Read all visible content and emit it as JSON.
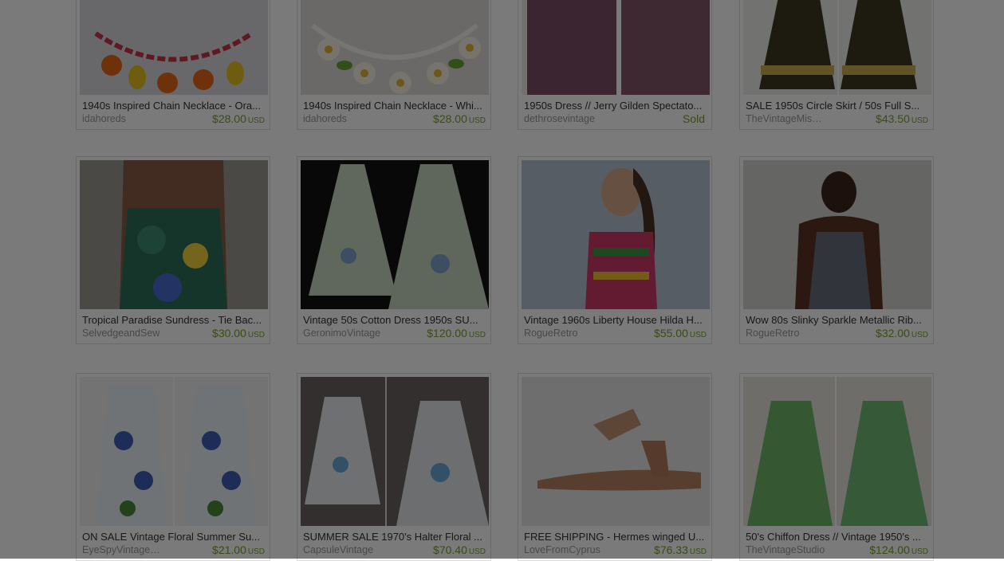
{
  "listings": [
    {
      "title": "1940s Inspired Chain Necklace - Ora...",
      "shop": "idahoreds",
      "price": "$28.00",
      "currency": "USD",
      "image": "orange-lemon-necklace"
    },
    {
      "title": "1940s Inspired Chain Necklace - Whi...",
      "shop": "idahoreds",
      "price": "$28.00",
      "currency": "USD",
      "image": "daisy-necklace"
    },
    {
      "title": "1950s Dress // Jerry Gilden Spectato...",
      "shop": "dethrosevintage",
      "price": "Sold",
      "currency": "",
      "image": "maroon-dress"
    },
    {
      "title": "SALE 1950s Circle Skirt / 50s Full S...",
      "shop": "TheVintageMis…",
      "price": "$43.50",
      "currency": "USD",
      "image": "circle-skirt"
    },
    {
      "title": "Tropical Paradise Sundress - Tie Bac...",
      "shop": "SelvedgeandSew",
      "price": "$30.00",
      "currency": "USD",
      "image": "tropical-sundress"
    },
    {
      "title": "Vintage 50s Cotton Dress 1950s SU...",
      "shop": "GeronimoVintage",
      "price": "$120.00",
      "currency": "USD",
      "image": "floral-halter-dress"
    },
    {
      "title": "Vintage 1960s Liberty House Hilda H...",
      "shop": "RogueRetro",
      "price": "$55.00",
      "currency": "USD",
      "image": "colorful-top"
    },
    {
      "title": "Wow 80s Slinky Sparkle Metallic Rib...",
      "shop": "RogueRetro",
      "price": "$32.00",
      "currency": "USD",
      "image": "metallic-halter"
    },
    {
      "title": "ON SALE Vintage Floral Summer Su...",
      "shop": "EyeSpyVintage…",
      "price": "$21.00",
      "currency": "USD",
      "image": "blue-floral-dress"
    },
    {
      "title": "SUMMER SALE 1970's Halter Floral ...",
      "shop": "CapsuleVintage",
      "price": "$70.40",
      "currency": "USD",
      "image": "halter-floral-dress"
    },
    {
      "title": "FREE SHIPPING - Hermes winged U...",
      "shop": "LoveFromCyprus",
      "price": "$76.33",
      "currency": "USD",
      "image": "winged-sandal"
    },
    {
      "title": "50's Chiffon Dress // Vintage 1950's ...",
      "shop": "TheVintageStudio",
      "price": "$124.00",
      "currency": "USD",
      "image": "green-chiffon-dress"
    }
  ],
  "colors": {
    "price": "#78a12a",
    "sold": "#78a12a",
    "overlay": "rgba(0,0,0,0.52)"
  }
}
